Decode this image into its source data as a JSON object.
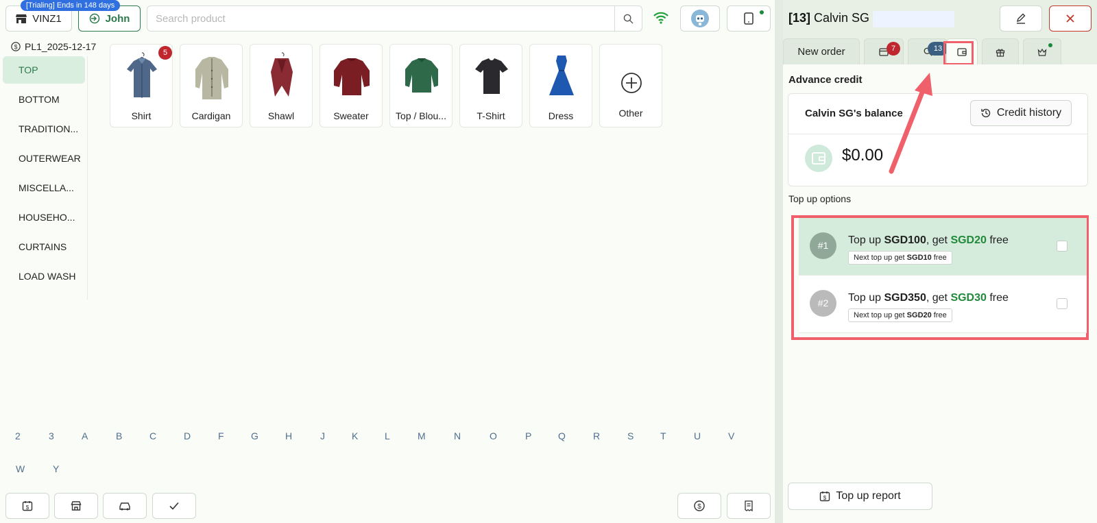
{
  "header": {
    "trial_badge": "[Trialing] Ends in 148 days",
    "store_label": "VINZ1",
    "user_label": "John",
    "search_placeholder": "Search product"
  },
  "pricelist": "PL1_2025-12-17",
  "categories": [
    "TOP",
    "BOTTOM",
    "TRADITION...",
    "OUTERWEAR",
    "MISCELLA...",
    "HOUSEHO...",
    "CURTAINS",
    "LOAD WASH"
  ],
  "products": [
    {
      "label": "Shirt",
      "badge": "5"
    },
    {
      "label": "Cardigan"
    },
    {
      "label": "Shawl"
    },
    {
      "label": "Sweater"
    },
    {
      "label": "Top / Blou..."
    },
    {
      "label": "T-Shirt"
    },
    {
      "label": "Dress"
    },
    {
      "label": "Other"
    }
  ],
  "alphabet": [
    "2",
    "3",
    "A",
    "B",
    "C",
    "D",
    "F",
    "G",
    "H",
    "J",
    "K",
    "L",
    "M",
    "N",
    "O",
    "P",
    "Q",
    "R",
    "S",
    "T",
    "U",
    "V",
    "W",
    "Y"
  ],
  "customer": {
    "id": "[13]",
    "name": "Calvin SG"
  },
  "tabs": {
    "new_order": "New order",
    "orders_badge": "7",
    "search_badge": "13"
  },
  "credit": {
    "section_title": "Advance credit",
    "balance_title": "Calvin SG's balance",
    "history_button": "Credit history",
    "balance": "$0.00",
    "topup_title": "Top up options",
    "options": [
      {
        "num": "#1",
        "pre": "Top up ",
        "amount": "SGD100",
        "mid": ", get ",
        "free": "SGD20",
        "post": " free",
        "note_pre": "Next top up get ",
        "note_amount": "SGD10",
        "note_post": " free"
      },
      {
        "num": "#2",
        "pre": "Top up ",
        "amount": "SGD350",
        "mid": ", get ",
        "free": "SGD30",
        "post": " free",
        "note_pre": "Next top up get ",
        "note_amount": "SGD20",
        "note_post": " free"
      }
    ],
    "report_button": "Top up report"
  },
  "colors": {
    "accent_green": "#2a7a4a",
    "highlight_red": "#f0606a",
    "badge_red": "#c0262d",
    "badge_blue": "#3a5f80",
    "trial_blue": "#2f6fe0"
  }
}
